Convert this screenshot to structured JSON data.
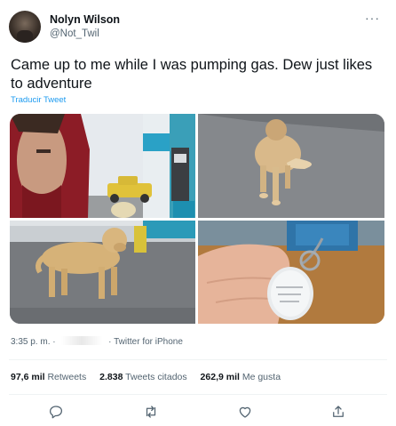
{
  "user": {
    "name": "Nolyn Wilson",
    "handle": "@Not_Twil"
  },
  "more_label": "···",
  "tweet": {
    "text": "Came up to me while I was pumping gas. Dew just likes to adventure",
    "translate_label": "Traducir Tweet"
  },
  "media": {
    "photos": [
      "photo-selfie-gas-station",
      "photo-dog-walking",
      "photo-dog-standing",
      "photo-dog-tag"
    ]
  },
  "meta": {
    "time": "3:35 p. m.",
    "separator": "·",
    "source": "Twitter for iPhone"
  },
  "stats": {
    "retweets_count": "97,6 mil",
    "retweets_label": "Retweets",
    "quotes_count": "2.838",
    "quotes_label": "Tweets citados",
    "likes_count": "262,9 mil",
    "likes_label": "Me gusta"
  },
  "actions": [
    "reply-icon",
    "retweet-icon",
    "like-icon",
    "share-icon"
  ],
  "colors": {
    "link": "#1d9bf0",
    "secondary_text": "#536471",
    "primary_text": "#0f1419"
  }
}
